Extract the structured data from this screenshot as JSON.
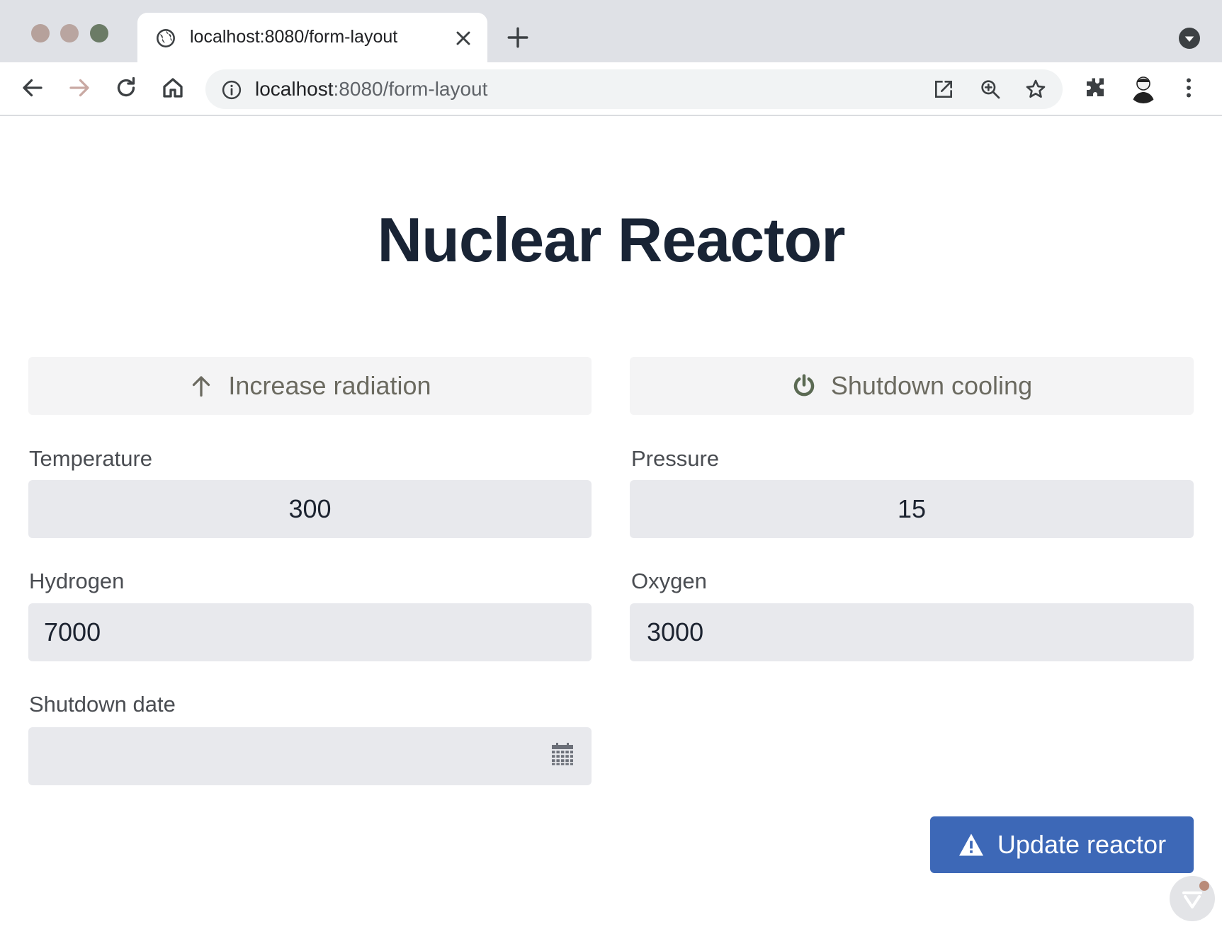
{
  "browser": {
    "tab": {
      "title": "localhost:8080/form-layout"
    },
    "address": {
      "host": "localhost",
      "path": ":8080/form-layout"
    }
  },
  "page": {
    "title": "Nuclear Reactor",
    "actions": {
      "increase_radiation": "Increase radiation",
      "shutdown_cooling": "Shutdown cooling"
    },
    "fields": {
      "temperature": {
        "label": "Temperature",
        "value": "300"
      },
      "pressure": {
        "label": "Pressure",
        "value": "15"
      },
      "hydrogen": {
        "label": "Hydrogen",
        "value": "7000"
      },
      "oxygen": {
        "label": "Oxygen",
        "value": "3000"
      },
      "shutdown_date": {
        "label": "Shutdown date",
        "value": ""
      }
    },
    "submit": "Update reactor"
  },
  "colors": {
    "title": "#192435",
    "primary_button": "#3d68b7",
    "secondary_button_bg": "#f4f4f5",
    "field_bg": "#e8e9ed"
  },
  "icons": {
    "increase_radiation": "arrow-up-icon",
    "shutdown_cooling": "power-icon",
    "shutdown_date": "calendar-icon",
    "submit": "warning-icon"
  }
}
